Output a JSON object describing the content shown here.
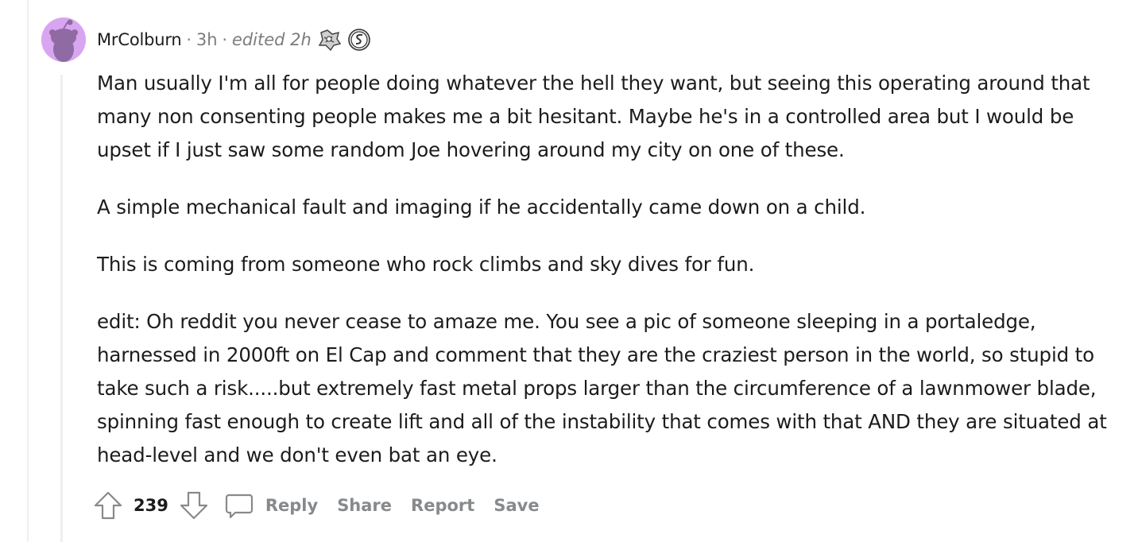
{
  "comment": {
    "author": "MrColburn",
    "separator": "·",
    "time": "3h",
    "edited": "edited 2h",
    "avatar_color": "#d8a6f0",
    "awards": [
      "award-icon-1",
      "award-icon-2"
    ],
    "paragraphs": [
      "Man usually I'm all for people doing whatever the hell they want, but seeing this operating around that many non consenting people makes me a bit hesitant. Maybe he's in a controlled area but I would be upset if I just saw some random Joe hovering around my city on one of these.",
      "A simple mechanical fault and imaging if he accidentally came down on a child.",
      "This is coming from someone who rock climbs and sky dives for fun.",
      "edit: Oh reddit you never cease to amaze me. You see a pic of someone sleeping in a portaledge, harnessed in 2000ft on El Cap and comment that they are the craziest person in the world, so stupid to take such a risk.....but extremely fast metal props larger than the circumference of a lawnmower blade, spinning fast enough to create lift and all of the instability that comes with that AND they are situated at head-level and we don't even bat an eye."
    ]
  },
  "actions": {
    "score": "239",
    "reply": "Reply",
    "share": "Share",
    "report": "Report",
    "save": "Save"
  }
}
